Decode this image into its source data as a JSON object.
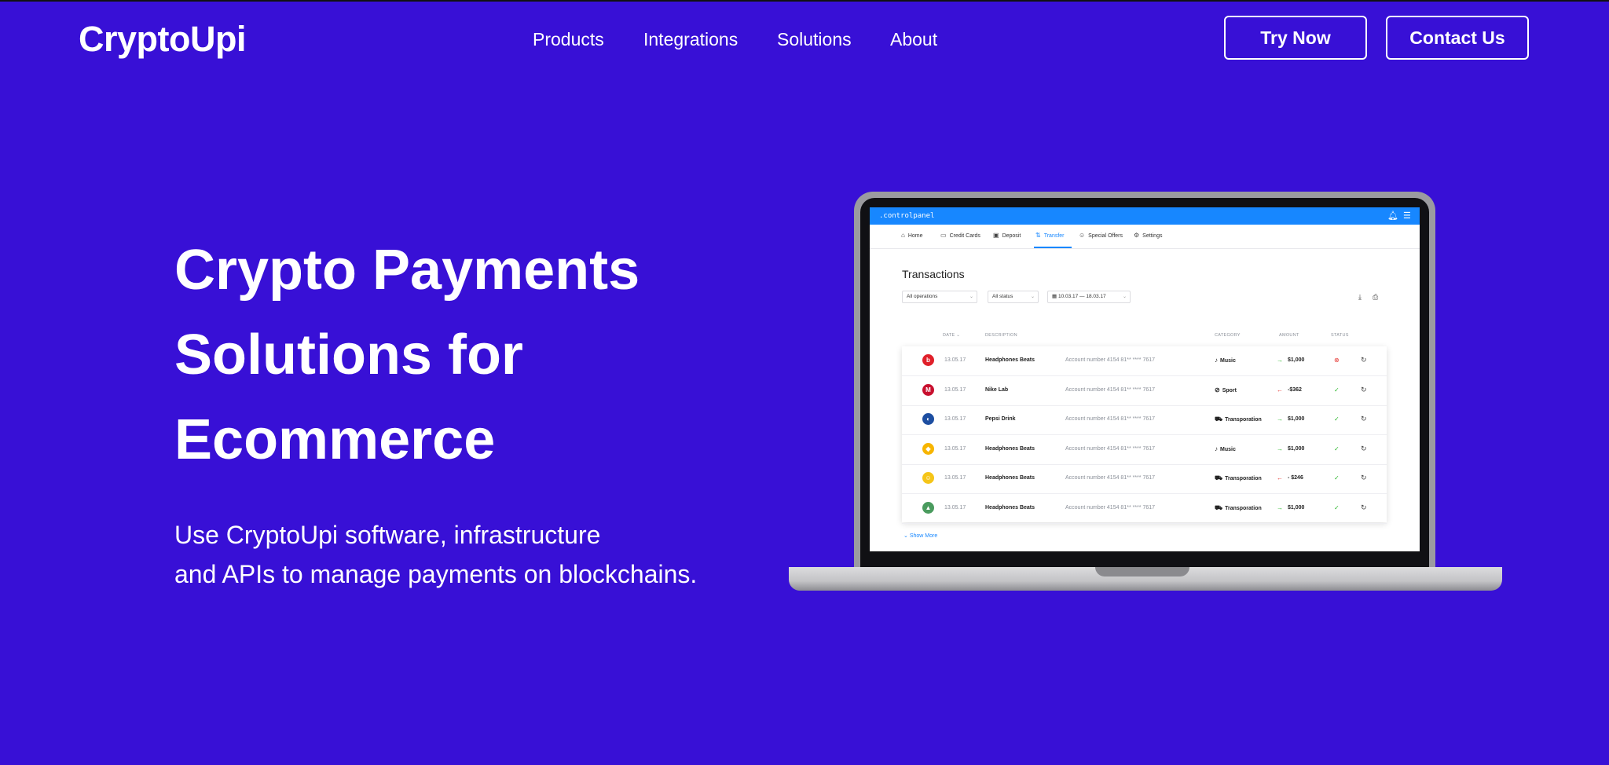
{
  "brand": {
    "logo": "CryptoUpi"
  },
  "nav": {
    "products": "Products",
    "integrations": "Integrations",
    "solutions": "Solutions",
    "about": "About"
  },
  "actions": {
    "try_now": "Try Now",
    "contact_us": "Contact Us"
  },
  "hero": {
    "title_line1": "Crypto Payments",
    "title_line2": "Solutions for",
    "title_line3": "Ecommerce",
    "subtitle_line1": "Use CryptoUpi software, infrastructure",
    "subtitle_line2": "and APIs to manage payments on blockchains."
  },
  "colors": {
    "background": "#3810d6",
    "panel_accent": "#1787ff",
    "positive": "#2eb82e",
    "negative": "#e53935"
  },
  "control_panel": {
    "title": ".controlpanel",
    "tabs": [
      "Home",
      "Credit Cards",
      "Deposit",
      "Transfer",
      "Special Offers",
      "Settings"
    ],
    "active_tab": "Transfer",
    "section_title": "Transactions",
    "filters": {
      "operations": "All operations",
      "status": "All status",
      "date_range": "10.03.17 — 18.03.17"
    },
    "columns": {
      "date": "DATE",
      "description": "DESCRIPTION",
      "category": "CATEGORY",
      "amount": "AMOUNT",
      "status": "STATUS"
    },
    "rows": [
      {
        "logo": "beats-logo",
        "date": "13.05.17",
        "description": "Headphones Beats",
        "account": "Account number 4154 81** **** 7617",
        "category": "Music",
        "category_icon": "music-icon",
        "direction": "in",
        "amount": "$1,000",
        "status": "failed"
      },
      {
        "logo": "mcdonalds-logo",
        "date": "13.05.17",
        "description": "Nike Lab",
        "account": "Account number 4154 81** **** 7617",
        "category": "Sport",
        "category_icon": "sport-icon",
        "direction": "out",
        "amount": "-$362",
        "status": "success"
      },
      {
        "logo": "pepsi-logo",
        "date": "13.05.17",
        "description": "Pepsi Drink",
        "account": "Account number 4154 81** **** 7617",
        "category": "Transporation",
        "category_icon": "truck-icon",
        "direction": "in",
        "amount": "$1,000",
        "status": "success"
      },
      {
        "logo": "sketch-logo",
        "date": "13.05.17",
        "description": "Headphones Beats",
        "account": "Account number 4154 81** **** 7617",
        "category": "Music",
        "category_icon": "music-icon",
        "direction": "in",
        "amount": "$1,000",
        "status": "success"
      },
      {
        "logo": "emoji-logo",
        "date": "13.05.17",
        "description": "Headphones Beats",
        "account": "Account number 4154 81** **** 7617",
        "category": "Transporation",
        "category_icon": "truck-icon",
        "direction": "out",
        "amount": "- $246",
        "status": "success"
      },
      {
        "logo": "landscape-logo",
        "date": "13.05.17",
        "description": "Headphones Beats",
        "account": "Account number 4154 81** **** 7617",
        "category": "Transporation",
        "category_icon": "truck-icon",
        "direction": "in",
        "amount": "$1,000",
        "status": "success"
      }
    ],
    "show_more": "Show More"
  }
}
